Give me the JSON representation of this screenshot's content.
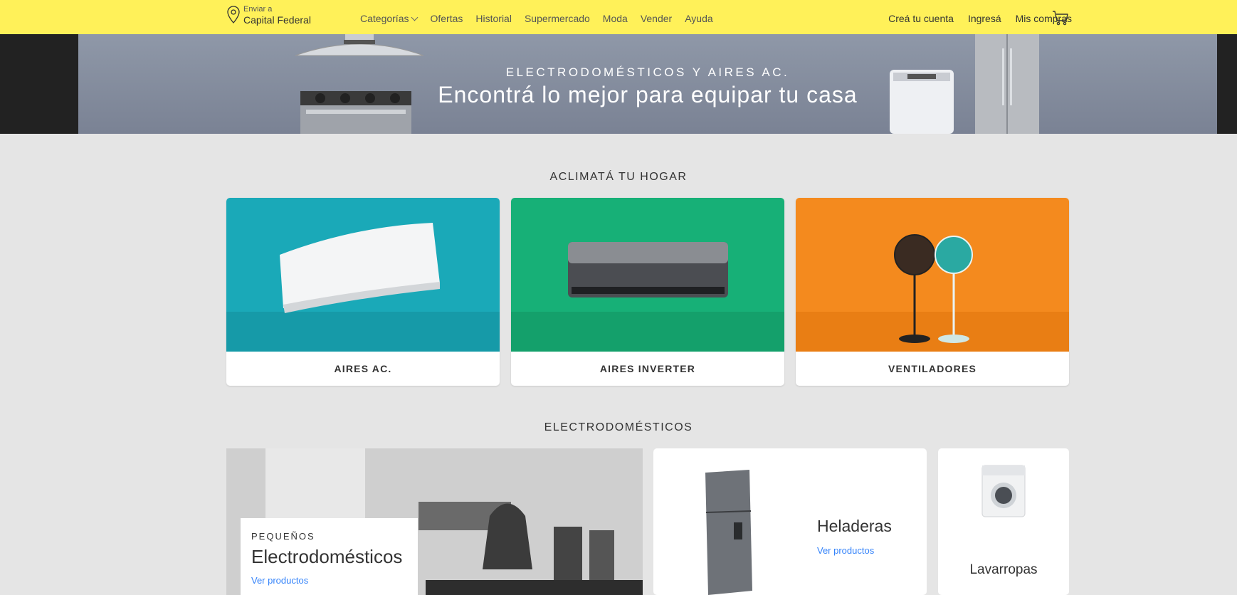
{
  "header": {
    "location_small": "Enviar a",
    "location_big": "Capital Federal",
    "nav": [
      "Categorías",
      "Ofertas",
      "Historial",
      "Supermercado",
      "Moda",
      "Vender",
      "Ayuda"
    ],
    "right_nav": [
      "Creá tu cuenta",
      "Ingresá",
      "Mis compras"
    ],
    "bg_color": "#fff159"
  },
  "banner": {
    "subtitle": "ELECTRODOMÉSTICOS Y AIRES AC.",
    "title": "Encontrá lo mejor para equipar tu casa"
  },
  "climate": {
    "title": "ACLIMATÁ TU HOGAR",
    "cards": [
      {
        "label": "AIRES AC.",
        "bg": "#1aa9b8"
      },
      {
        "label": "AIRES INVERTER",
        "bg": "#17b077"
      },
      {
        "label": "VENTILADORES",
        "bg": "#f48a1e"
      }
    ]
  },
  "appliances": {
    "title": "ELECTRODOMÉSTICOS",
    "featured": {
      "small": "PEQUEÑOS",
      "big": "Electrodomésticos",
      "link": "Ver productos"
    },
    "heladeras": {
      "title": "Heladeras",
      "link": "Ver productos"
    },
    "lavarropas": {
      "title": "Lavarropas"
    }
  }
}
